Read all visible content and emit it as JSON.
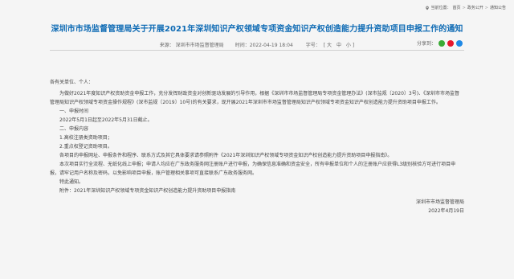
{
  "breadcrumb": {
    "prefix": "当前位置：",
    "items": [
      "首页",
      "政务公开",
      "通知公告"
    ]
  },
  "article": {
    "title": "深圳市市场监督管理局关于开展2021年深圳知识产权领域专项资金知识产权创造能力提升资助项目申报工作的通知",
    "source_label": "来源：",
    "source_value": "深圳市市场监督管理局",
    "date": "时间：2022-04-19 18:04",
    "font_size_label": "字号：",
    "font_sizes": [
      "大",
      "中",
      "小"
    ],
    "share_label": "分享到：",
    "greeting": "各有关单位、个人：",
    "paragraphs": [
      "为做好2021年度知识产权资助资金申报工作，充分发挥财政资金对创新驱动发展的引导作用，根据《深圳市市场监督管理局专项资金管理办法》(深市监规〔2020〕3号)、《深圳市市场监督管理局知识产权领域专项资金操作规程》(深市监规〔2019〕10号)的有关要求，现开展2021年深圳市市场监督管理局知识产权领域专项资金知识产权创造能力提升资助项目申报工作。",
      "一、申报时间",
      "2022年5月1日起至2022年5月31日截止。",
      "二、申报内容",
      "1.高校注册类资助项目；",
      "2.重点权登记资助项目。",
      "各项目的申报网址、申报条件和程序、联系方式及其它具体要求请参照附件《2021年深圳知识产权领域专项资金知识产权创造能力提升资助项目申报指南》。",
      "本次项目实行全流程、无纸化线上申报；申请人均应在广东政务服务网注册账户进行申报，为确保信息准确和资金安全，所有申报单位和个人的注册账户应获得L3级别核验方可进行项目申报，请牢记用户名称及密码，以免影响项目申报，账户管理相关事项可直接联系广东政务服务网。",
      "特此通知。",
      "附件：2021年深圳知识产权领域专项资金知识产权创造能力提升资助项目申报指南"
    ],
    "signature": "深圳市市场监督管理局",
    "sign_date": "2022年4月19日"
  },
  "colors": {
    "title": "#0d6ab4",
    "share_wechat": "#3aaa35",
    "share_weibo": "#e6162d",
    "share_qq": "#1e88e5"
  }
}
